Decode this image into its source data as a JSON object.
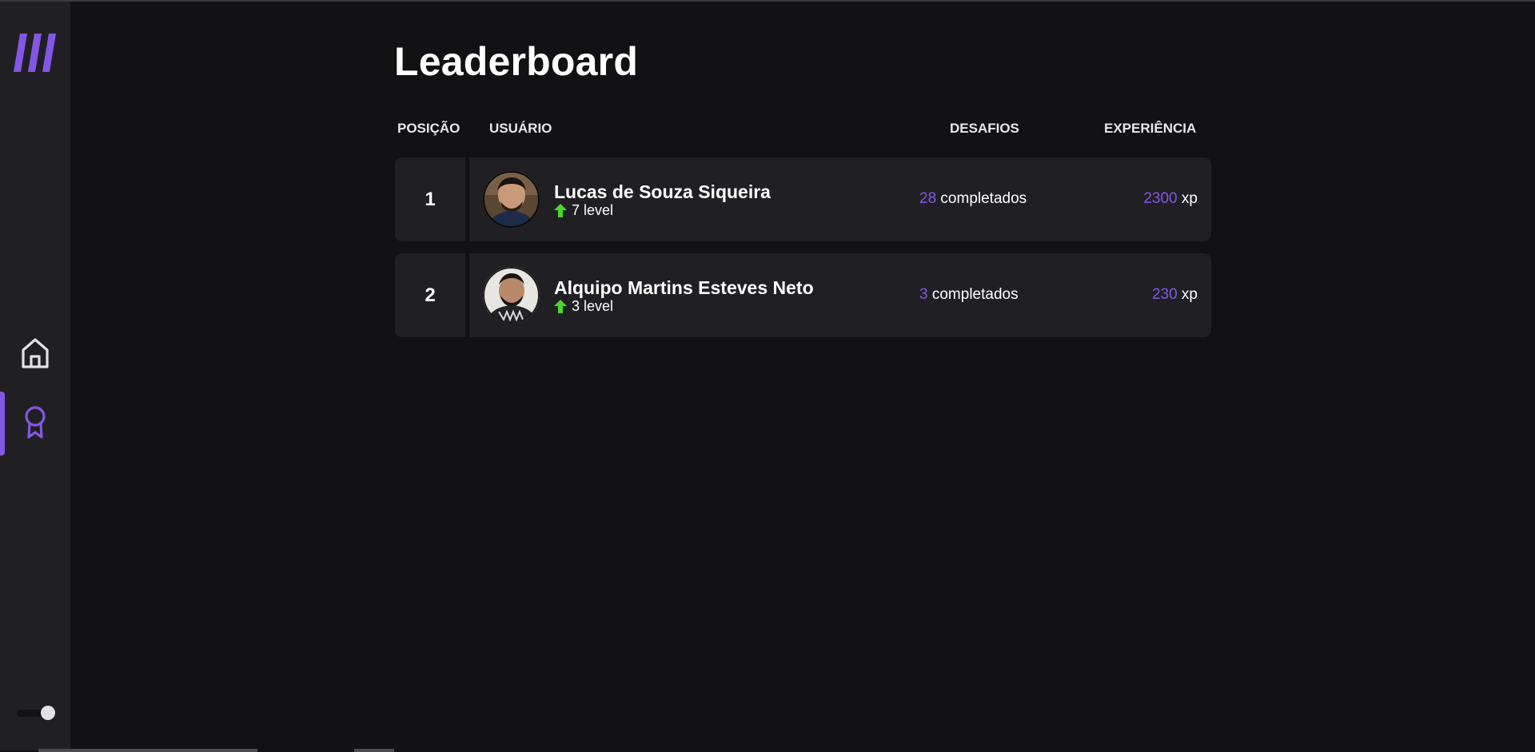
{
  "colors": {
    "accent": "#8257e5",
    "background": "#121214",
    "surface": "#202024",
    "level_up": "#4cd62b"
  },
  "sidebar": {
    "logo_icon": "logo-icon",
    "items": [
      {
        "icon": "home-icon",
        "active": false
      },
      {
        "icon": "award-icon",
        "active": true
      }
    ],
    "theme_toggle": {
      "icon": "toggle-switch",
      "state": "on"
    }
  },
  "page": {
    "title": "Leaderboard"
  },
  "table": {
    "headers": {
      "position": "POSIÇÃO",
      "user": "USUÁRIO",
      "challenges": "DESAFIOS",
      "experience": "EXPERIÊNCIA"
    },
    "rows": [
      {
        "position": "1",
        "name": "Lucas de Souza Siqueira",
        "level": "7 level",
        "challenges_count": "28",
        "challenges_suffix": "completados",
        "xp_value": "2300",
        "xp_unit": "xp"
      },
      {
        "position": "2",
        "name": "Alquipo Martins Esteves Neto",
        "level": "3 level",
        "challenges_count": "3",
        "challenges_suffix": "completados",
        "xp_value": "230",
        "xp_unit": "xp"
      }
    ]
  }
}
